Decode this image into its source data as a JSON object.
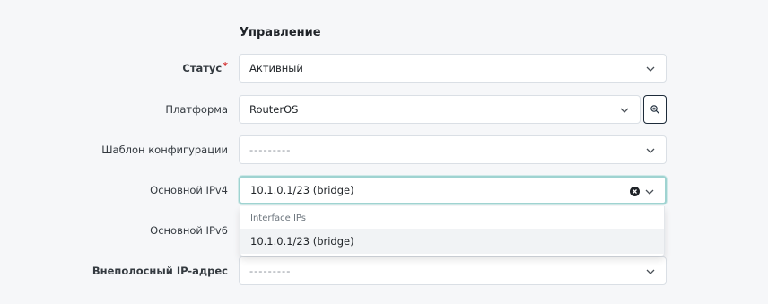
{
  "header_cut": "· · · · · · · · · · · · · · · ·",
  "section": {
    "title": "Управление"
  },
  "fields": {
    "status": {
      "label": "Статус",
      "required_mark": "*",
      "value": "Активный"
    },
    "platform": {
      "label": "Платформа",
      "value": "RouterOS"
    },
    "config_template": {
      "label": "Шаблон конфигурации",
      "value": "---------"
    },
    "primary_ipv4": {
      "label": "Основной IPv4",
      "value": "10.1.0.1/23 (bridge)"
    },
    "primary_ipv6": {
      "label": "Основной IPv6"
    },
    "oob_ip": {
      "label": "Внеполосный IP-адрес",
      "value": "---------"
    }
  },
  "dropdown": {
    "group_label": "Interface IPs",
    "options": [
      "10.1.0.1/23 (bridge)"
    ]
  },
  "colors": {
    "background": "#f6f7f9",
    "focus_border": "#9fd3d1",
    "required": "#d63939",
    "icon_button_border": "#1d2b3a"
  },
  "icons": {
    "chevron": "chevron-down-icon",
    "clear": "clear-icon",
    "platform_button": "filter-settings-icon"
  }
}
